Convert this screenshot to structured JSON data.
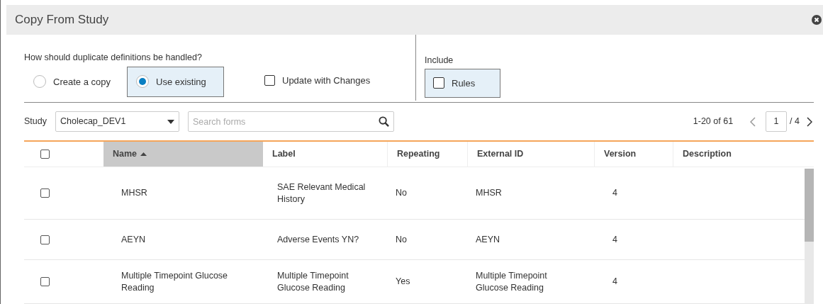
{
  "dialog": {
    "title": "Copy From Study"
  },
  "duplicates": {
    "question": "How should duplicate definitions be handled?",
    "options": [
      {
        "label": "Create a copy",
        "selected": false
      },
      {
        "label": "Use existing",
        "selected": true
      }
    ],
    "update_with_changes": {
      "label": "Update with Changes",
      "checked": false
    }
  },
  "include": {
    "label": "Include",
    "rules": {
      "label": "Rules",
      "checked": false
    }
  },
  "toolbar": {
    "study_label": "Study",
    "study_value": "Cholecap_DEV1",
    "search": {
      "placeholder": "Search forms"
    },
    "range": "1-20 of 61",
    "page": "1",
    "pages": "/ 4"
  },
  "table": {
    "select_all": {
      "checked": false
    },
    "columns": [
      {
        "label": "Name",
        "selected": true,
        "sorted": true
      },
      {
        "label": "Label",
        "selected": false,
        "sorted": false
      },
      {
        "label": "Repeating",
        "selected": false,
        "sorted": false
      },
      {
        "label": "External ID",
        "selected": false,
        "sorted": false
      },
      {
        "label": "Version",
        "selected": false,
        "sorted": false
      },
      {
        "label": "Description",
        "selected": false,
        "sorted": false
      }
    ],
    "rows": [
      {
        "checked": false,
        "cells": [
          "MHSR",
          "SAE Relevant Medical History",
          "No",
          "MHSR",
          "4"
        ]
      },
      {
        "checked": false,
        "cells": [
          "AEYN",
          "Adverse Events YN?",
          "No",
          "AEYN",
          "4"
        ]
      },
      {
        "checked": false,
        "cells": [
          "Multiple Timepoint Glucose Reading",
          "Multiple Timepoint Glucose Reading",
          "Yes",
          "Multiple Timepoint Glucose Reading",
          "4"
        ]
      }
    ]
  }
}
